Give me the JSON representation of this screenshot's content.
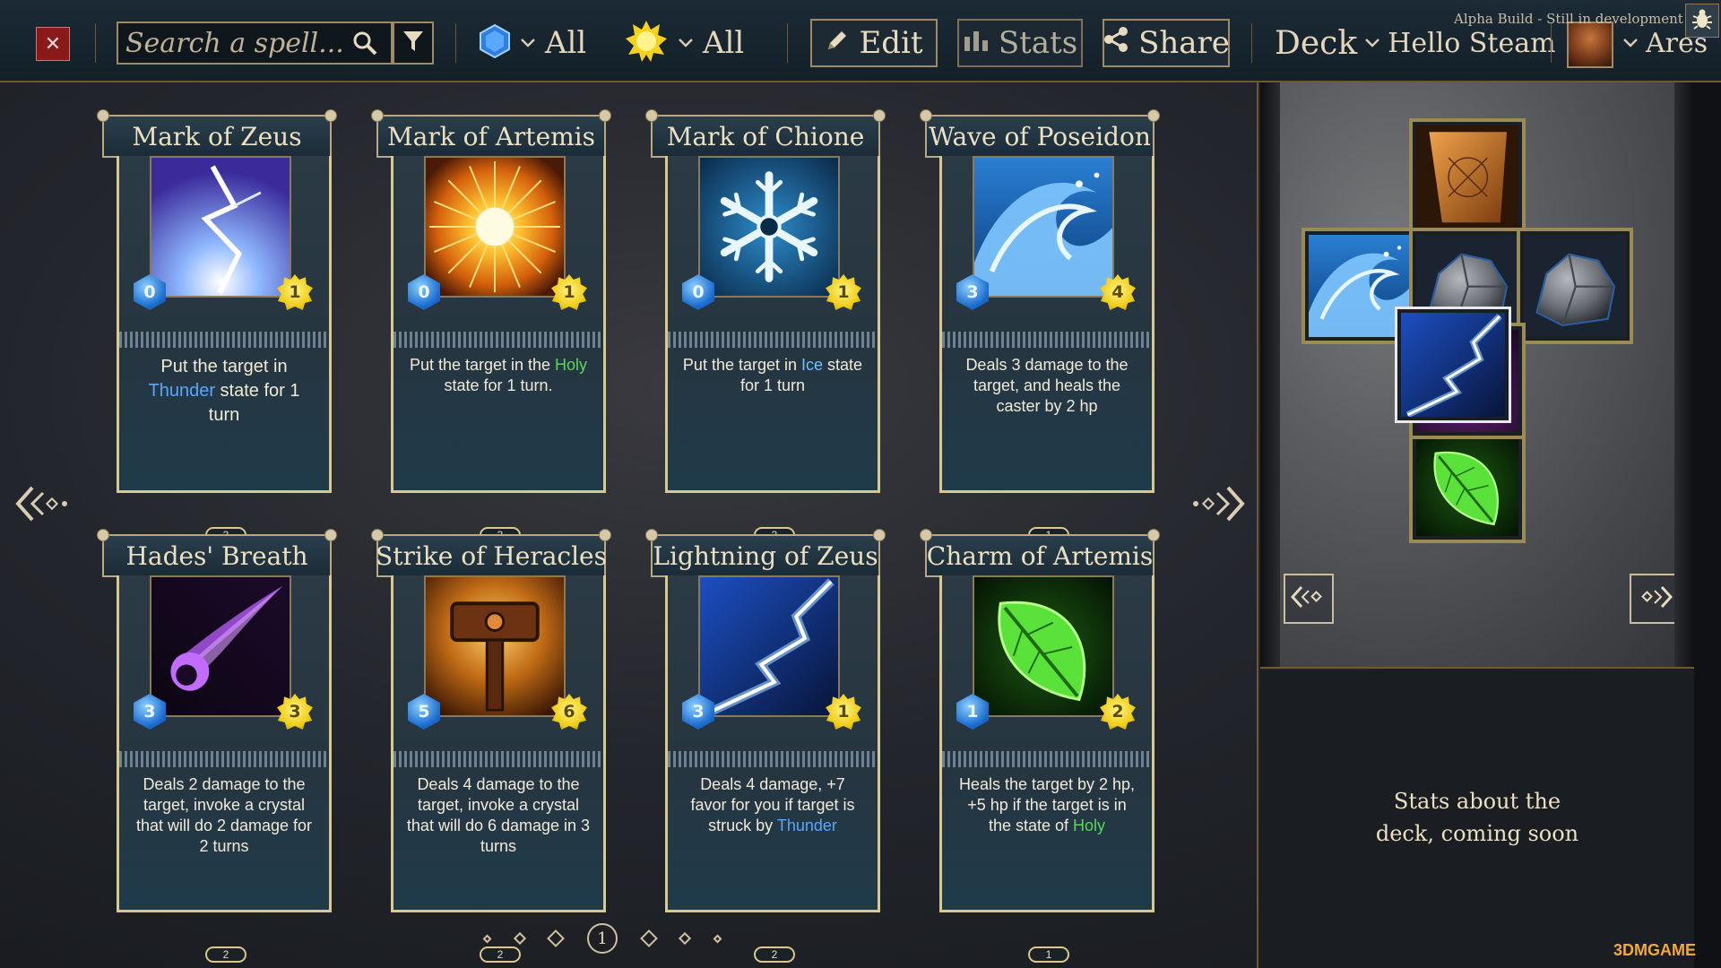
{
  "header": {
    "close_symbol": "✕",
    "search_placeholder": "Search a spell...",
    "gem_filter_label": "All",
    "sun_filter_label": "All",
    "edit_label": "Edit",
    "stats_label": "Stats",
    "share_label": "Share",
    "deck_label": "Deck",
    "deck_name": "Hello Steam",
    "player_name": "Ares",
    "build_note": "Alpha Build - Still in development"
  },
  "cards": [
    {
      "name": "Mark of Zeus",
      "cost": "0",
      "power": "1",
      "count": "3",
      "art": "lightning",
      "desc": [
        {
          "t": "Put the target in "
        },
        {
          "t": "Thunder",
          "k": "thunder"
        },
        {
          "t": " state for 1 turn"
        }
      ],
      "large": true
    },
    {
      "name": "Mark of Artemis",
      "cost": "0",
      "power": "1",
      "count": "3",
      "art": "sun",
      "desc": [
        {
          "t": "Put the target in the "
        },
        {
          "t": "Holy",
          "k": "holy"
        },
        {
          "t": " state for 1 turn."
        }
      ]
    },
    {
      "name": "Mark of Chione",
      "cost": "0",
      "power": "1",
      "count": "3",
      "art": "snowflake",
      "desc": [
        {
          "t": "Put the target in "
        },
        {
          "t": "Ice",
          "k": "ice"
        },
        {
          "t": " state for 1 turn"
        }
      ]
    },
    {
      "name": "Wave of Poseidon",
      "cost": "3",
      "power": "4",
      "count": "1",
      "art": "wave",
      "desc": [
        {
          "t": "Deals 3 damage to the target, and heals the caster by 2 hp"
        }
      ]
    },
    {
      "name": "Hades' Breath",
      "cost": "3",
      "power": "3",
      "count": "2",
      "art": "comet",
      "desc": [
        {
          "t": "Deals 2 damage to the target, invoke a crystal that will do 2 damage for 2 turns"
        }
      ]
    },
    {
      "name": "Strike of Heracles",
      "cost": "5",
      "power": "6",
      "count": "2",
      "art": "hammer",
      "desc": [
        {
          "t": "Deals 4 damage to the target, invoke a crystal that will do 6 damage in 3 turns"
        }
      ]
    },
    {
      "name": "Lightning of Zeus",
      "cost": "3",
      "power": "1",
      "count": "2",
      "art": "bolt",
      "desc": [
        {
          "t": "Deals 4 damage, +7 favor for you if target is struck by "
        },
        {
          "t": "Thunder",
          "k": "thunder"
        }
      ]
    },
    {
      "name": "Charm of Artemis",
      "cost": "1",
      "power": "2",
      "count": "1",
      "art": "leaf",
      "desc": [
        {
          "t": "Heals the target by 2 hp, +5 hp if the target is in the state of "
        },
        {
          "t": "Holy",
          "k": "holy"
        }
      ]
    }
  ],
  "pagination": {
    "current_page": "1"
  },
  "deck_slots": [
    {
      "art": "map"
    },
    {
      "art": "wave"
    },
    {
      "art": "rock"
    },
    {
      "art": "rock"
    },
    {
      "art": "bolt"
    },
    {
      "art": "leaf"
    }
  ],
  "stats_panel": {
    "text_line1": "Stats about the",
    "text_line2": "deck, coming soon"
  },
  "watermark": "3DMGAME"
}
